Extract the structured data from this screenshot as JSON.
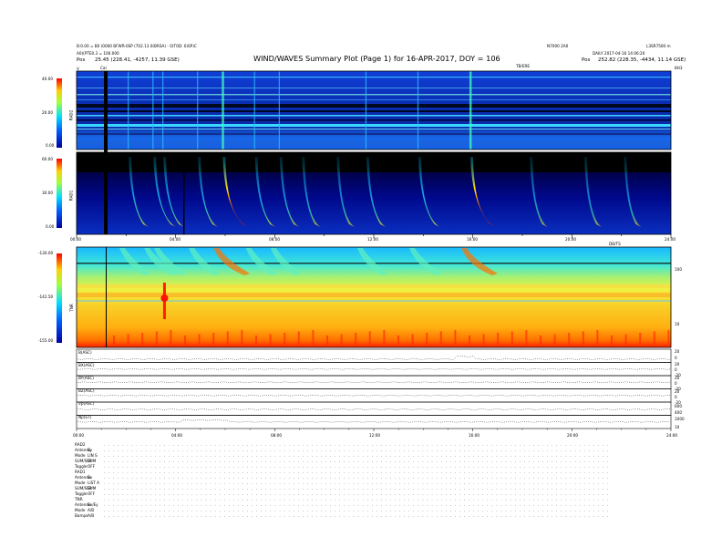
{
  "header": {
    "title": "WIND/WAVES Summary Plot (Page 1) for 16-APR-2017, DOY = 106",
    "left_line1": "B:0.00 = B0 (0000 BFWR-0SP (702.13 0(BRSA) - 0)T0D: 0)SP)C",
    "left_line2": "A0)(PTE0.3 = 100.000",
    "left_pos_label": "Pos",
    "left_pos_value": "25.45 (228.41, -4257, 11.39 GSE)",
    "right_top1": "N7000 2A0",
    "right_top2": "L3SR7500 m",
    "right_line2": "DAILY 2017-04-16 14:06:20",
    "right_pos_label": "Pos",
    "right_pos_value": "252.82 (228.35, -4434, 11.14 GSE)",
    "cal_label": "Cal",
    "mid_tag": "TB/ERE",
    "marker_v": "V",
    "marker_right": "8H3"
  },
  "chart_data": [
    {
      "type": "heatmap",
      "name": "RAD2",
      "y_ticks": [
        "40.00",
        "20.00",
        "0.00"
      ],
      "ylim": [
        0,
        40
      ],
      "xlim": [
        0,
        24
      ]
    },
    {
      "type": "heatmap",
      "name": "RAD1",
      "y_ticks": [
        "60.00",
        "30.00",
        "0.00"
      ],
      "ylim": [
        0,
        60
      ],
      "x_ticks": [
        "00:00",
        "04:00",
        "08:00",
        "12:00",
        "16:00",
        "20:00",
        "24:00"
      ],
      "x_axis_tag": "DB/TS",
      "xlim": [
        0,
        24
      ]
    },
    {
      "type": "heatmap",
      "name": "TNR",
      "y_ticks": [
        "-130.00",
        "-142.50",
        "-155.00"
      ],
      "ylim": [
        -155,
        -130
      ],
      "right_ticks": [
        "100",
        "10"
      ],
      "xlim": [
        0,
        24
      ]
    },
    {
      "type": "line",
      "name": "magnetometer",
      "panels": [
        {
          "label": "B(ASC)",
          "right": [
            "20",
            "0"
          ]
        },
        {
          "label": "BX(ASC)",
          "right": [
            "20",
            "0",
            "-20"
          ]
        },
        {
          "label": "BY(ASC)",
          "right": [
            "20",
            "0",
            "-20"
          ]
        },
        {
          "label": "BZ(ASC)",
          "right": [
            "20",
            "0",
            "-20"
          ]
        },
        {
          "label": "Vp(ASC)",
          "right": [
            "600",
            "400"
          ]
        },
        {
          "label": "Np(ST)",
          "right": [
            "1000",
            "10"
          ]
        }
      ],
      "x_ticks": [
        "00:00",
        "04:00",
        "08:00",
        "12:00",
        "16:00",
        "20:00",
        "24:00"
      ],
      "xlim": [
        0,
        24
      ]
    }
  ],
  "status_rows": [
    {
      "label": "RAD2",
      "value": ""
    },
    {
      "label": "Antenna",
      "value": "Ey"
    },
    {
      "label": "Mode",
      "value": "LIN S"
    },
    {
      "label": "SUM/SEP",
      "value": "SUM"
    },
    {
      "label": "Toggle",
      "value": "OFF"
    },
    {
      "label": "RAD1",
      "value": ""
    },
    {
      "label": "Antenna",
      "value": "Ex"
    },
    {
      "label": "Mode",
      "value": "LIST A"
    },
    {
      "label": "SUM/SEP",
      "value": "SUM"
    },
    {
      "label": "Toggle",
      "value": "OFF"
    },
    {
      "label": "TNR",
      "value": ""
    },
    {
      "label": "Antenna",
      "value": "Ex/Ey"
    },
    {
      "label": "Mode",
      "value": "A/B"
    },
    {
      "label": "Bamps",
      "value": "A/B"
    }
  ],
  "colors": {
    "spectrogram_low": "#0000a0",
    "spectrogram_mid": "#1e90ff",
    "burst_high": "#ff2000",
    "tnr_background": "#f0f040"
  }
}
